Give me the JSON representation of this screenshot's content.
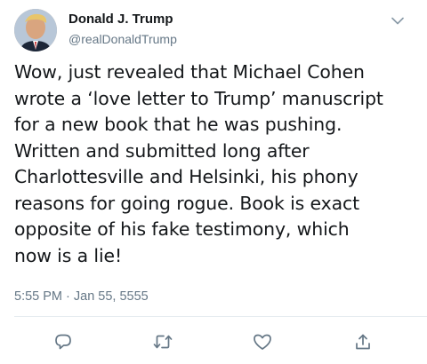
{
  "author": {
    "name": "Donald J. Trump",
    "handle": "@realDonaldTrump"
  },
  "tweet": {
    "text": "Wow, just revealed that Michael Cohen\nwrote a ‘love letter to Trump’ manuscript\nfor a new book that he was pushing.\nWritten and submitted long after\nCharlottesville and Helsinki, his phony\nreasons for going rogue. Book is exact\nopposite of his fake testimony, which\nnow is a lie!",
    "timestamp": "5:55 PM · Jan 55, 5555"
  },
  "icons": {
    "menu": "chevron-down-icon",
    "reply": "reply-icon",
    "retweet": "retweet-icon",
    "like": "heart-icon",
    "share": "share-icon"
  },
  "colors": {
    "text": "#14171a",
    "secondary": "#657786",
    "icon": "#657786",
    "divider": "#e6ecf0"
  }
}
